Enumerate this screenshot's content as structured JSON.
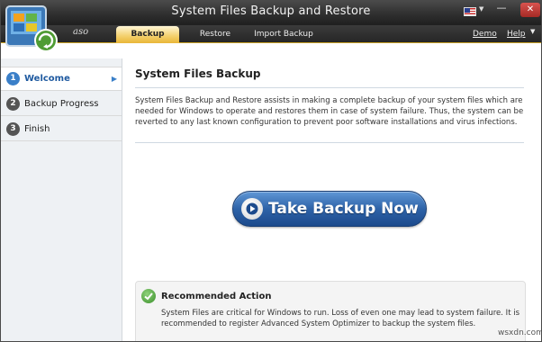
{
  "window": {
    "title": "System Files Backup and Restore",
    "logo_text": "aso",
    "minimize_glyph": "—",
    "close_glyph": "✕"
  },
  "tabs": [
    {
      "label": "Backup",
      "active": true
    },
    {
      "label": "Restore",
      "active": false
    },
    {
      "label": "Import Backup",
      "active": false
    }
  ],
  "top_links": {
    "demo": "Demo",
    "help": "Help"
  },
  "sidebar": {
    "steps": [
      {
        "number": "1",
        "label": "Welcome",
        "active": true
      },
      {
        "number": "2",
        "label": "Backup Progress",
        "active": false
      },
      {
        "number": "3",
        "label": "Finish",
        "active": false
      }
    ]
  },
  "main": {
    "heading": "System Files Backup",
    "description": "System Files Backup and Restore assists in making a complete backup of your system files which are needed for Windows to operate and restores them in case of system failure. Thus, the system can be reverted to any last known configuration to prevent poor software installations and virus infections.",
    "cta_label": "Take Backup Now",
    "recommended": {
      "title": "Recommended Action",
      "text": "System Files are critical for Windows to run. Loss of even one may lead to system failure. It is recommended to register Advanced System Optimizer to backup the system files."
    }
  },
  "watermark": "wsxdn.com",
  "colors": {
    "accent_tab": "#f3cf6a",
    "cta_blue": "#2e63a8",
    "sidebar_active": "#3a7fc8"
  },
  "icons": [
    "aso-logo-icon",
    "us-flag-icon",
    "minimize-icon",
    "close-icon",
    "play-icon",
    "check-icon"
  ]
}
